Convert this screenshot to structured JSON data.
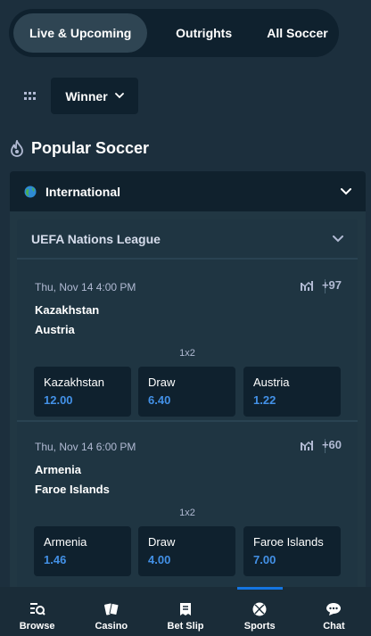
{
  "top_tabs": [
    {
      "label": "Live & Upcoming",
      "active": true
    },
    {
      "label": "Outrights",
      "active": false
    },
    {
      "label": "All Soccer",
      "active": false
    }
  ],
  "filter": {
    "selected": "Winner",
    "icon": "grid-icon"
  },
  "section": {
    "title": "Popular Soccer",
    "icon": "fire-icon"
  },
  "region": {
    "label": "International",
    "icon": "globe-icon"
  },
  "league": {
    "name": "UEFA Nations League"
  },
  "matches": [
    {
      "time": "Thu, Nov 14 4:00 PM",
      "more": "+97",
      "home": "Kazakhstan",
      "away": "Austria",
      "market": "1x2",
      "odds": [
        {
          "name": "Kazakhstan",
          "price": "12.00"
        },
        {
          "name": "Draw",
          "price": "6.40"
        },
        {
          "name": "Austria",
          "price": "1.22"
        }
      ]
    },
    {
      "time": "Thu, Nov 14 6:00 PM",
      "more": "+60",
      "home": "Armenia",
      "away": "Faroe Islands",
      "market": "1x2",
      "odds": [
        {
          "name": "Armenia",
          "price": "1.46"
        },
        {
          "name": "Draw",
          "price": "4.00"
        },
        {
          "name": "Faroe Islands",
          "price": "7.00"
        }
      ]
    }
  ],
  "bottom_nav": [
    {
      "label": "Browse",
      "icon": "browse-icon",
      "active": false
    },
    {
      "label": "Casino",
      "icon": "casino-icon",
      "active": false
    },
    {
      "label": "Bet Slip",
      "icon": "betslip-icon",
      "active": false
    },
    {
      "label": "Sports",
      "icon": "sports-icon",
      "active": true
    },
    {
      "label": "Chat",
      "icon": "chat-icon",
      "active": false
    }
  ],
  "colors": {
    "background": "#1c2f3d",
    "panel": "#0f212e",
    "accent": "#1475e1",
    "odds": "#4391e7"
  }
}
